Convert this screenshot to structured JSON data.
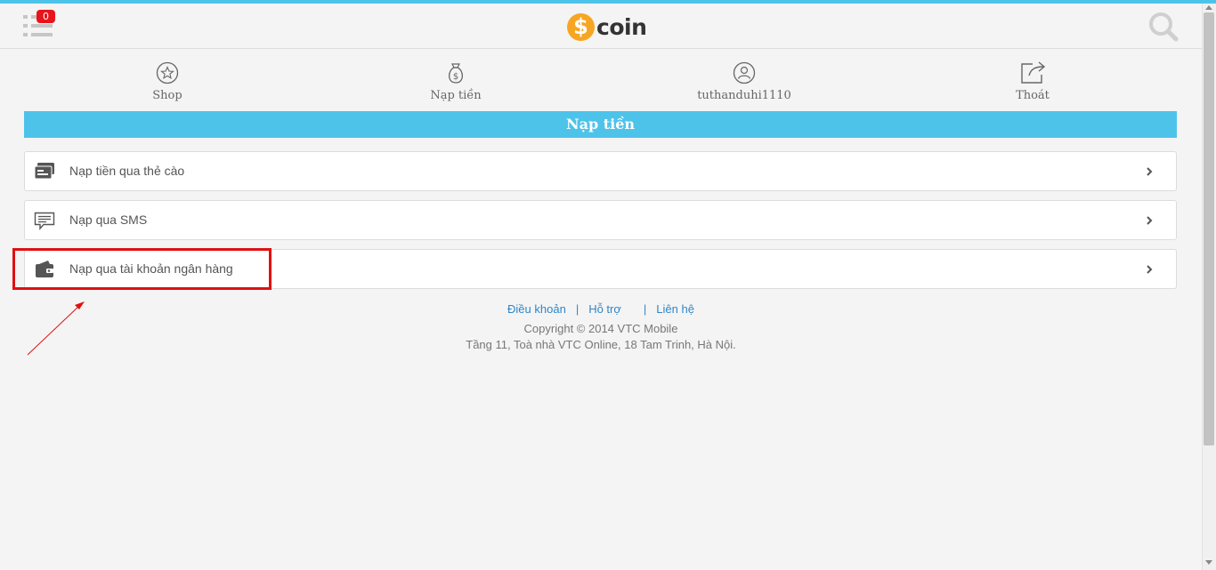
{
  "header": {
    "notification_count": "0",
    "logo_symbol": "$",
    "logo_text": "coin",
    "menu_icon": "hamburger-list-icon",
    "search_icon": "search-icon"
  },
  "nav": [
    {
      "label": "Shop",
      "icon": "star-circle-icon"
    },
    {
      "label": "Nạp tiền",
      "icon": "money-bag-icon"
    },
    {
      "label": "tuthanduhi1110",
      "icon": "user-circle-icon"
    },
    {
      "label": "Thoát",
      "icon": "logout-share-icon"
    }
  ],
  "section_title": "Nạp tiền",
  "options": [
    {
      "label": "Nạp tiền qua thẻ cào",
      "icon": "card-icon"
    },
    {
      "label": "Nạp qua SMS",
      "icon": "sms-message-icon"
    },
    {
      "label": "Nạp qua tài khoản ngân hàng",
      "icon": "wallet-icon"
    }
  ],
  "footer": {
    "links": [
      "Điều khoản",
      "Hỗ trợ",
      "Liên hệ"
    ],
    "separator": "|",
    "copyright": "Copyright © 2014 VTC Mobile",
    "address": "Tầng 11, Toà nhà VTC Online, 18 Tam Trinh, Hà Nội."
  },
  "colors": {
    "accent": "#4ec3ea",
    "badge": "#e8141c",
    "logo_coin": "#f6a623",
    "link": "#2f86c9",
    "highlight": "#e01010"
  }
}
